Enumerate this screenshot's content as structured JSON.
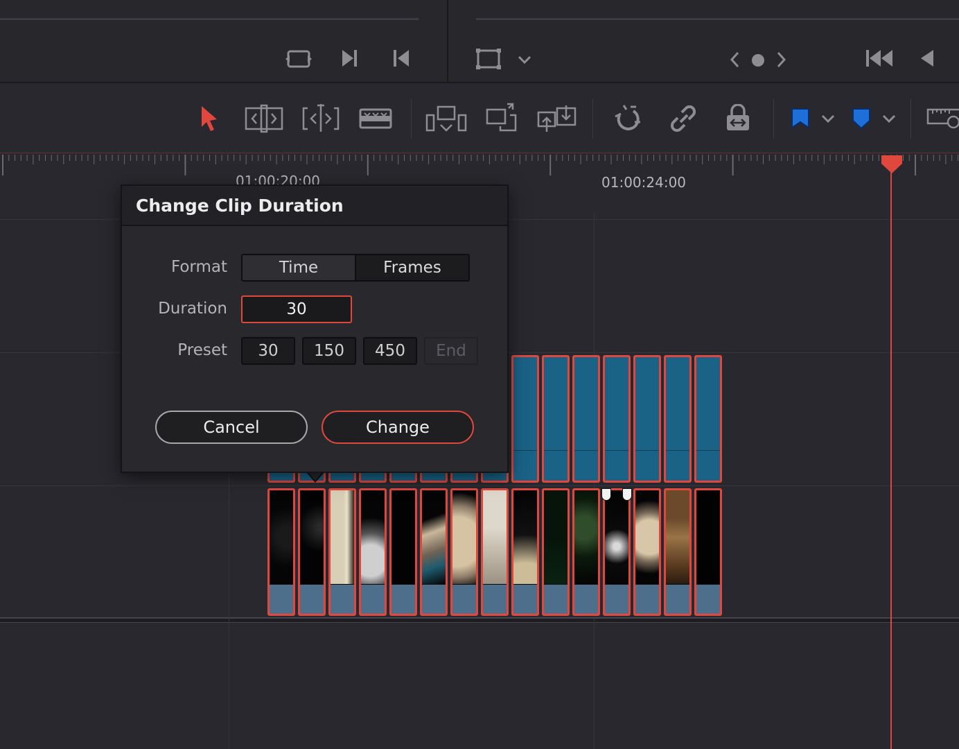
{
  "timeline": {
    "ruler_labels": [
      "01:00:20:00",
      "01:00:24:00"
    ]
  },
  "dialog": {
    "title": "Change Clip Duration",
    "format_label": "Format",
    "format_options": [
      "Time",
      "Frames"
    ],
    "format_selected": "Frames",
    "duration_label": "Duration",
    "duration_value": "30",
    "preset_label": "Preset",
    "presets": [
      "30",
      "150",
      "450",
      "End"
    ],
    "cancel_label": "Cancel",
    "change_label": "Change"
  },
  "colors": {
    "accent": "#e0473d",
    "video_clip": "#1a6286",
    "audio_clip": "#4d6f8c",
    "flag_blue": "#1e6fd9",
    "background": "#28282e"
  },
  "icons": {
    "viewer_left": [
      "loop-icon",
      "next-edit-icon",
      "previous-edit-icon"
    ],
    "viewer_right": [
      "viewer-frame-icon",
      "chevron-down-icon",
      "chevron-left-icon",
      "record-dot-icon",
      "chevron-right-icon",
      "skip-to-start-icon",
      "play-reverse-icon"
    ],
    "toolbar": [
      "selection-arrow-icon",
      "trim-edit-icon",
      "dynamic-trim-icon",
      "blade-icon",
      "insert-clip-icon",
      "overwrite-clip-icon",
      "replace-clip-icon",
      "snapping-icon",
      "linked-selection-icon",
      "position-lock-icon",
      "flag-icon",
      "chevron-down-icon",
      "marker-icon",
      "chevron-down-icon",
      "zoom-ruler-icon"
    ]
  }
}
